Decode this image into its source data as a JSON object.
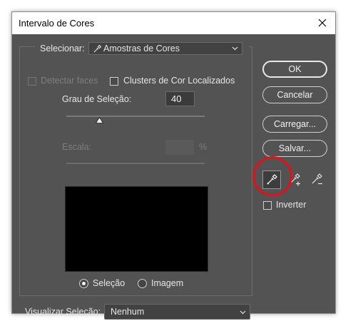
{
  "window": {
    "title": "Intervalo de Cores"
  },
  "select_row": {
    "label": "Selecionar:",
    "value": "Amostras de Cores"
  },
  "options": {
    "detect_faces_label": "Detectar faces",
    "localized_clusters_label": "Clusters de Cor Localizados"
  },
  "fuzziness": {
    "label": "Grau de Seleção:",
    "value": "40",
    "level_percent": 40
  },
  "range": {
    "label": "Escala:",
    "unit": "%"
  },
  "preview_mode": {
    "selection_label": "Seleção",
    "image_label": "Imagem",
    "selected": "selection"
  },
  "selection_preview": {
    "label": "Visualizar Seleção:",
    "value": "Nenhum"
  },
  "buttons": {
    "ok": "OK",
    "cancel": "Cancelar",
    "load": "Carregar...",
    "save": "Salvar..."
  },
  "invert": {
    "label": "Inverter",
    "checked": false
  },
  "colors": {
    "dialog_bg": "#535353",
    "highlight": "#e3101b"
  }
}
